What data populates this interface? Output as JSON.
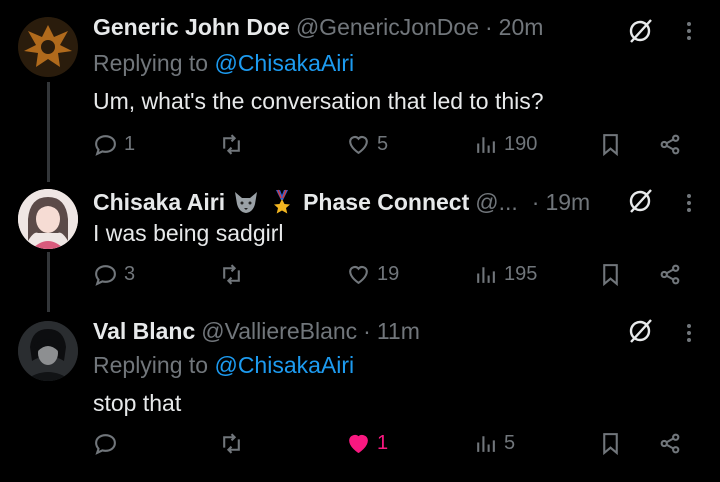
{
  "tweets": [
    {
      "name": "Generic John Doe",
      "handle": "@GenericJonDoe",
      "sep": "·",
      "time": "20m",
      "replying_prefix": "Replying to",
      "replying_to": "@ChisakaAiri",
      "text": "Um, what's the conversation that led to this?",
      "replies": "1",
      "retweets": "",
      "likes": "5",
      "views": "190"
    },
    {
      "name": "Chisaka Airi",
      "badge": "Phase Connect",
      "handle": "@...",
      "sep": "·",
      "time": "19m",
      "text": "I was being sadgirl",
      "replies": "3",
      "retweets": "",
      "likes": "19",
      "views": "195"
    },
    {
      "name": "Val Blanc",
      "handle": "@ValliereBlanc",
      "sep": "·",
      "time": "11m",
      "replying_prefix": "Replying to",
      "replying_to": "@ChisakaAiri",
      "text": "stop that",
      "replies": "",
      "retweets": "",
      "likes": "1",
      "views": "5"
    }
  ],
  "colors": {
    "background": "#000000",
    "text": "#e7e9ea",
    "muted": "#71767b",
    "link": "#1d9bf0",
    "like": "#f91880",
    "thread_line": "#333639"
  },
  "icons": [
    "reply-icon",
    "retweet-icon",
    "like-icon",
    "views-icon",
    "bookmark-icon",
    "share-icon",
    "grok-icon",
    "more-icon"
  ]
}
